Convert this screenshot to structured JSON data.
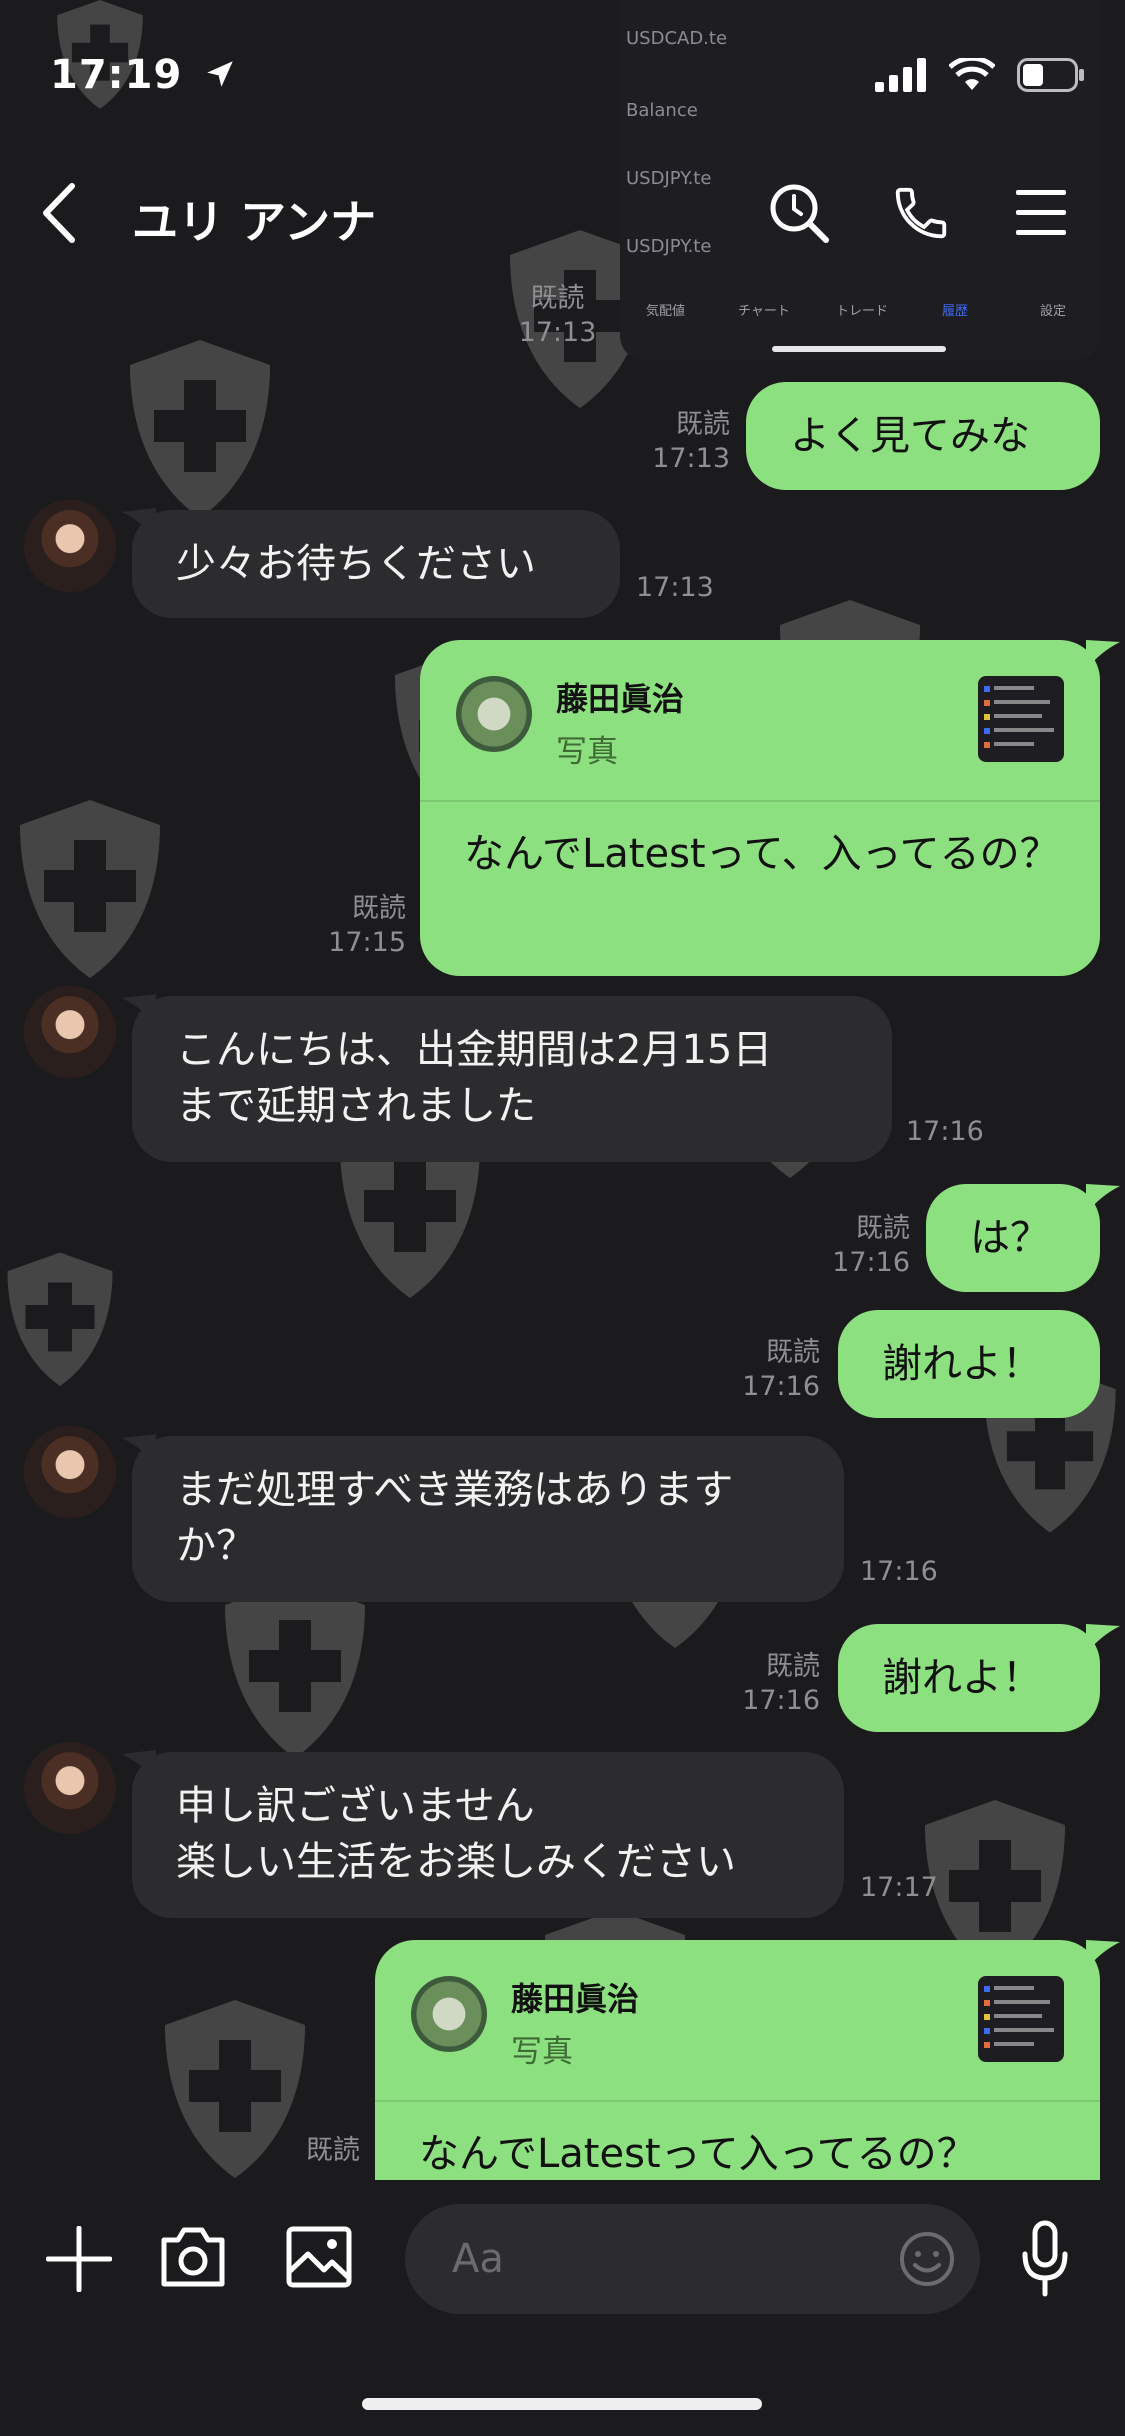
{
  "status_bar": {
    "time": "17:19"
  },
  "header": {
    "title": "ユリ アンナ"
  },
  "screenshot_remnant": {
    "rows": [
      "USDCAD.te",
      "Balance",
      "USDJPY.te",
      "USDJPY.te"
    ],
    "tabs": [
      "気配値",
      "チャート",
      "トレード",
      "履歴",
      "設定"
    ]
  },
  "messages": [
    {
      "id": "m0",
      "meta_read": "既読",
      "meta_time": "17:13"
    },
    {
      "id": "m1",
      "from": "me",
      "text": "よく見てみな",
      "read": "既読",
      "time": "17:13"
    },
    {
      "id": "m2",
      "from": "other",
      "text": "少々お待ちください",
      "time": "17:13"
    },
    {
      "id": "m3",
      "from": "me",
      "reply_name": "藤田眞治",
      "reply_type": "写真",
      "text": "なんでLatestって、入ってるの？",
      "read": "既読",
      "time": "17:15"
    },
    {
      "id": "m4",
      "from": "other",
      "text_lines": [
        "こんにちは、出金期間は2月15日",
        "まで延期されました"
      ],
      "time": "17:16"
    },
    {
      "id": "m5",
      "from": "me",
      "text": "は？",
      "read": "既読",
      "time": "17:16"
    },
    {
      "id": "m6",
      "from": "me",
      "text": "謝れよ！",
      "read": "既読",
      "time": "17:16"
    },
    {
      "id": "m7",
      "from": "other",
      "text_lines": [
        "まだ処理すべき業務はあります",
        "か？"
      ],
      "time": "17:16"
    },
    {
      "id": "m8",
      "from": "me",
      "text": "謝れよ！",
      "read": "既読",
      "time": "17:16"
    },
    {
      "id": "m9",
      "from": "other",
      "text_lines": [
        "申し訳ございません",
        "楽しい生活をお楽しみください"
      ],
      "time": "17:17"
    },
    {
      "id": "m10",
      "from": "me",
      "reply_name": "藤田眞治",
      "reply_type": "写真",
      "text": "なんでLatestって入ってるの？",
      "read": "既読"
    }
  ],
  "input": {
    "placeholder": "Aa"
  },
  "icons": [
    "back-icon",
    "search-icon",
    "phone-icon",
    "menu-icon",
    "plus-icon",
    "camera-icon",
    "image-icon",
    "emoji-icon",
    "mic-icon"
  ]
}
